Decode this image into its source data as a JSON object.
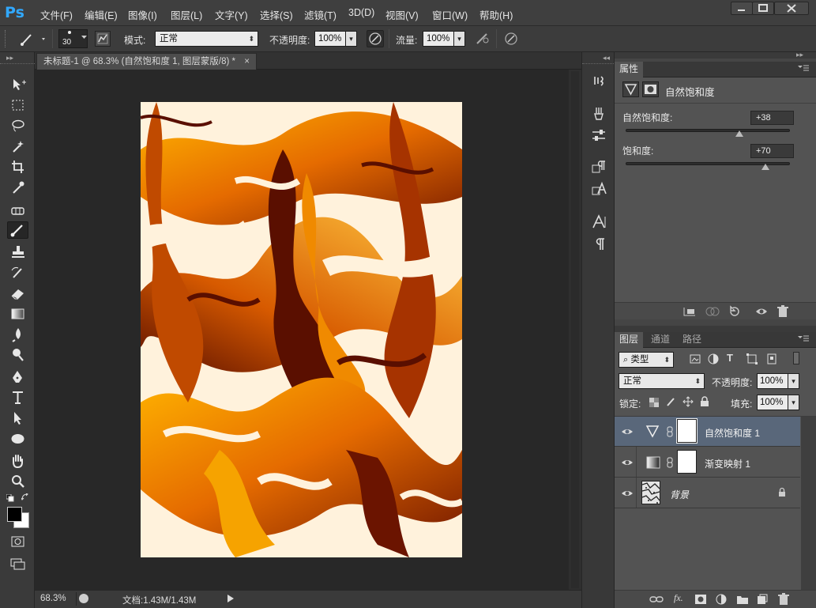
{
  "app": {
    "logo": "Ps"
  },
  "menu": [
    "文件(F)",
    "编辑(E)",
    "图像(I)",
    "图层(L)",
    "文字(Y)",
    "选择(S)",
    "滤镜(T)",
    "3D(D)",
    "视图(V)",
    "窗口(W)",
    "帮助(H)"
  ],
  "window_controls": [
    "minimize-icon",
    "maximize-icon",
    "close-icon"
  ],
  "options": {
    "brush_size": "30",
    "mode_label": "模式:",
    "mode_value": "正常",
    "opacity_label": "不透明度:",
    "opacity_value": "100%",
    "flow_label": "流量:",
    "flow_value": "100%"
  },
  "document": {
    "tab_title": "未标题-1 @ 68.3% (自然饱和度 1, 图层蒙版/8) *",
    "close": "×"
  },
  "status": {
    "zoom": "68.3%",
    "doc_info": "文档:1.43M/1.43M"
  },
  "properties": {
    "tab": "属性",
    "title": "自然饱和度",
    "vibrance_label": "自然饱和度:",
    "vibrance_value": "+38",
    "vibrance_fraction": 0.69,
    "saturation_label": "饱和度:",
    "saturation_value": "+70",
    "saturation_fraction": 0.85
  },
  "layers_panel": {
    "tabs": [
      "图层",
      "通道",
      "路径"
    ],
    "filter_label": "类型",
    "blend_mode": "正常",
    "opacity_label": "不透明度:",
    "opacity_value": "100%",
    "lock_label": "锁定:",
    "fill_label": "填充:",
    "fill_value": "100%",
    "layers": [
      {
        "name": "自然饱和度 1",
        "selected": true
      },
      {
        "name": "渐变映射 1",
        "selected": false
      },
      {
        "name": "背景",
        "selected": false,
        "locked": true
      }
    ]
  },
  "colors": {
    "accent": "#31a8ff",
    "selected_layer": "#5a6b82",
    "artwork_light": "#fff2dc",
    "artwork_orange": "#f08a00",
    "artwork_dark": "#5a0f00"
  }
}
